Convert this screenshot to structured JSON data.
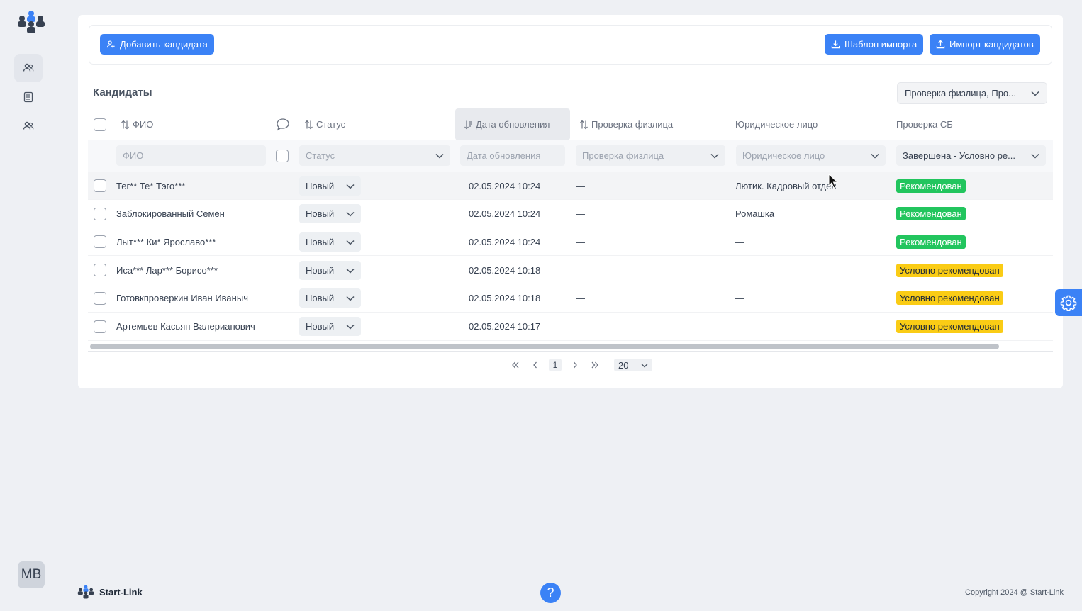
{
  "toolbar": {
    "add_label": "Добавить кандидата",
    "template_label": "Шаблон импорта",
    "import_label": "Импорт кандидатов"
  },
  "section": {
    "title": "Кандидаты",
    "columns_select": "Проверка физлица, Про..."
  },
  "columns": {
    "fio": "ФИО",
    "status": "Статус",
    "updated": "Дата обновления",
    "check_person": "Проверка физлица",
    "legal": "Юридическое лицо",
    "check_sb": "Проверка СБ"
  },
  "filters": {
    "fio": "ФИО",
    "status": "Статус",
    "updated": "Дата обновления",
    "check_person": "Проверка физлица",
    "legal": "Юридическое лицо",
    "check_sb": "Завершена - Условно ре..."
  },
  "rows": [
    {
      "name": "Тег** Те* Тэго***",
      "status": "Новый",
      "date": "02.05.2024 10:24",
      "check": "—",
      "legal": "Лютик. Кадровый отдел",
      "sb": "Рекомендован"
    },
    {
      "name": "Заблокированный Семён",
      "status": "Новый",
      "date": "02.05.2024 10:24",
      "check": "—",
      "legal": "Ромашка",
      "sb": "Рекомендован"
    },
    {
      "name": "Лыт*** Ки* Ярославо***",
      "status": "Новый",
      "date": "02.05.2024 10:24",
      "check": "—",
      "legal": "—",
      "sb": "Рекомендован"
    },
    {
      "name": "Иса*** Лар*** Борисо***",
      "status": "Новый",
      "date": "02.05.2024 10:18",
      "check": "—",
      "legal": "—",
      "sb": "Условно рекомендован"
    },
    {
      "name": "Готовкпроверкин Иван Иваныч",
      "status": "Новый",
      "date": "02.05.2024 10:18",
      "check": "—",
      "legal": "—",
      "sb": "Условно рекомендован"
    },
    {
      "name": "Артемьев Касьян Валерианович",
      "status": "Новый",
      "date": "02.05.2024 10:17",
      "check": "—",
      "legal": "—",
      "sb": "Условно рекомендован"
    }
  ],
  "pager": {
    "current": "1",
    "page_size": "20"
  },
  "user": {
    "initials": "MB"
  },
  "footer": {
    "brand": "Start-Link",
    "copyright": "Copyright 2024 @ Start-Link",
    "help": "?"
  },
  "colors": {
    "accent": "#3b82f6",
    "green": "#22c55e",
    "yellow": "#facc15"
  }
}
